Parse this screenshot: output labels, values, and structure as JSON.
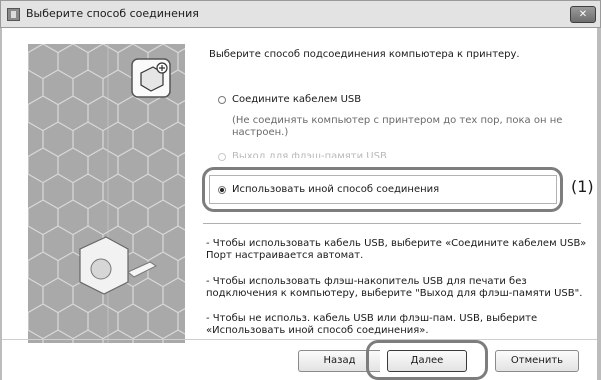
{
  "window": {
    "title": "Выберите способ соединения",
    "close_label": "✕"
  },
  "main": {
    "heading": "Выберите способ подсоединения компьютера к принтеру.",
    "options": [
      {
        "label": "Соедините кабелем USB",
        "selected": false,
        "enabled": true
      },
      {
        "label": "Выход для флэш-памяти USB",
        "selected": false,
        "enabled": false
      },
      {
        "label": "Использовать иной способ соединения",
        "selected": true,
        "enabled": true
      }
    ],
    "usb_note_line1": "(Не соединять компьютер с принтером до тех пор, пока он не",
    "usb_note_line2": "настроен.)",
    "callout": "(1)",
    "help": [
      [
        "- Чтобы использовать кабель USB, выберите «Соедините кабелем USB»",
        "Порт настраивается автомат."
      ],
      [
        "- Чтобы использовать флэш-накопитель USB для печати без",
        "подключения к компьютеру, выберите \"Выход для флэш-памяти USB\"."
      ],
      [
        "- Чтобы не использ. кабель USB или флэш-пам. USB, выберите",
        "«Использовать иной способ соединения»."
      ]
    ]
  },
  "buttons": {
    "back": "Назад",
    "next": "Далее",
    "cancel": "Отменить"
  }
}
